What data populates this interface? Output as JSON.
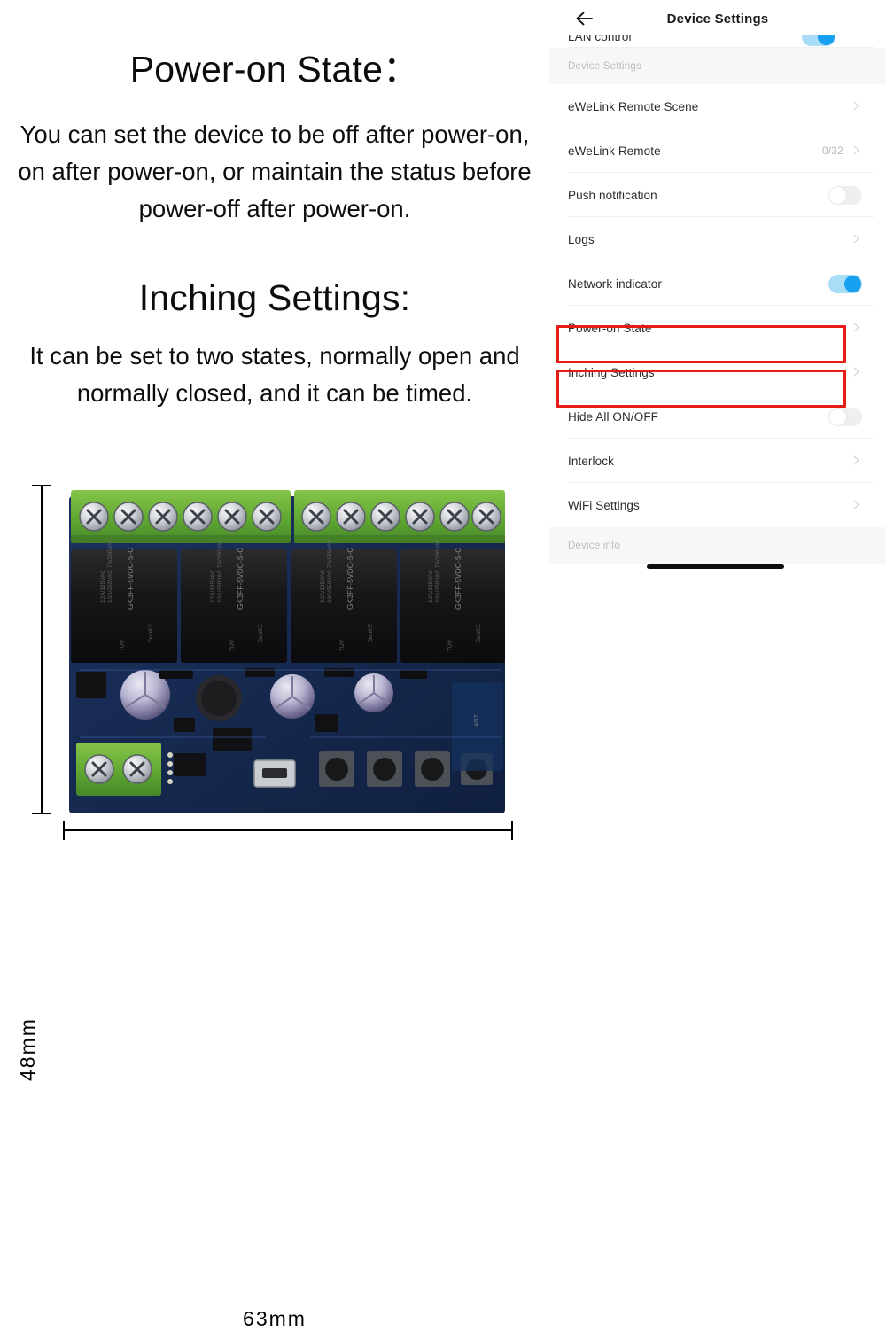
{
  "article": {
    "heading_1": "Power-on State：",
    "paragraph_1": "You can set the device to be off after power-on, on after power-on, or maintain the status before power-off after power-on.",
    "heading_2": "Inching Settings:",
    "paragraph_2": "It can be set to two states, normally open and normally closed, and it can be timed."
  },
  "product_diagram": {
    "height_label": "48mm",
    "width_label": "63mm",
    "relay_marking": "GK3FF-5VDC-S-C",
    "relay_brand": "GuoKE",
    "relay_ratings": "10A/250VAC 7A/250VAC 12A/125VAC",
    "cert_marks": "cULus TUV CQC"
  },
  "phone": {
    "nav": {
      "back_icon": "back-arrow-icon",
      "title": "Device Settings"
    },
    "rows": [
      {
        "label": "LAN control",
        "control": "toggle",
        "state": "on",
        "clipped": true
      },
      {
        "label": "Device Settings",
        "control": "section"
      },
      {
        "label": "eWeLink Remote Scene",
        "control": "chevron"
      },
      {
        "label": "eWeLink Remote",
        "control": "chevron",
        "value": "0/32"
      },
      {
        "label": "Push notification",
        "control": "toggle",
        "state": "off"
      },
      {
        "label": "Logs",
        "control": "chevron"
      },
      {
        "label": "Network indicator",
        "control": "toggle",
        "state": "on"
      },
      {
        "label": "Power-on State",
        "control": "chevron",
        "highlighted": true
      },
      {
        "label": "Inching Settings",
        "control": "chevron",
        "highlighted": true
      },
      {
        "label": "Hide All ON/OFF",
        "control": "toggle",
        "state": "off"
      },
      {
        "label": "Interlock",
        "control": "chevron"
      },
      {
        "label": "WiFi Settings",
        "control": "chevron"
      },
      {
        "label": "Device info",
        "control": "section"
      }
    ]
  },
  "colors": {
    "highlight_border": "#e51b17",
    "toggle_on_track": "#a9dcf7",
    "toggle_on_knob": "#17a0ef",
    "toggle_off_track": "#efefef",
    "section_bg": "#f7f7f7",
    "divider": "#f0f0f0",
    "label_text": "#2c2c2c",
    "muted_text": "#bdbdbd"
  }
}
